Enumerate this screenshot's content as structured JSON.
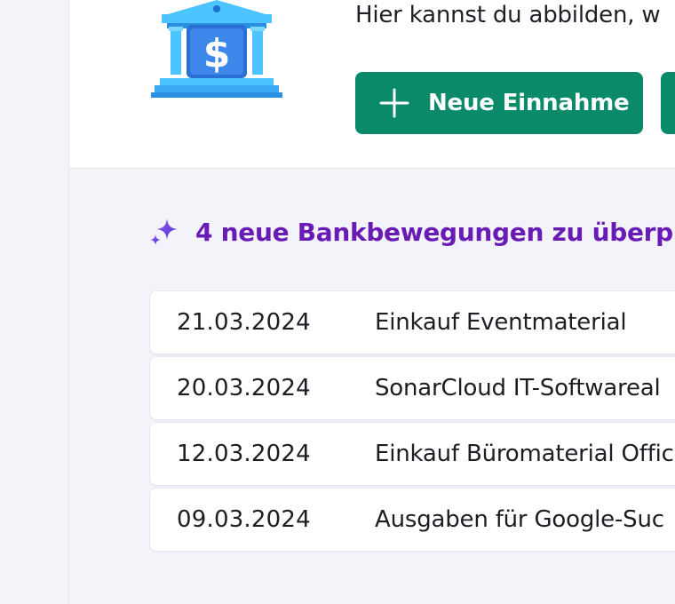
{
  "header": {
    "intro_text": "Hier kannst du abbilden, w",
    "primary_button_label": "Neue Einnahme"
  },
  "review": {
    "text": "4 neue Bankbewegungen zu überpr"
  },
  "transactions": [
    {
      "date": "21.03.2024",
      "description": "Einkauf Eventmaterial"
    },
    {
      "date": "20.03.2024",
      "description": "SonarCloud IT-Softwareal"
    },
    {
      "date": "12.03.2024",
      "description": "Einkauf Büromaterial Offic"
    },
    {
      "date": "09.03.2024",
      "description": "Ausgaben für Google-Suc"
    }
  ],
  "colors": {
    "accent_green": "#0b8a6a",
    "accent_purple": "#6a1bb6",
    "bank_blue": "#3aa0f0"
  },
  "icons": {
    "bank": "bank-dollar-icon",
    "plus": "plus-icon",
    "sparkle": "sparkle-icon"
  }
}
